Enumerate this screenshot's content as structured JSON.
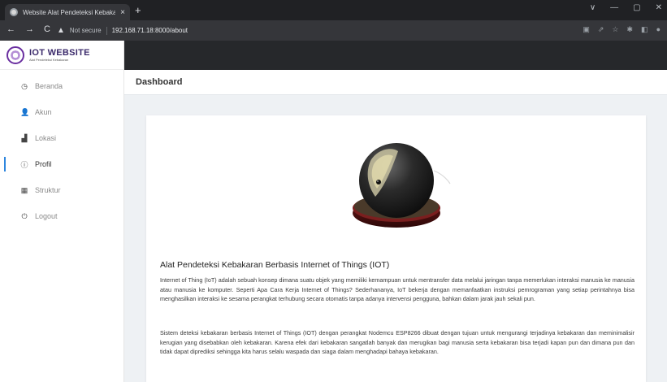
{
  "browser": {
    "tab_title": "Website Alat Pendeteksi Kebaka",
    "tab_close": "×",
    "new_tab": "+",
    "security_label": "Not secure",
    "url": "192.168.71.18:8000/about",
    "window_controls": [
      "∨",
      "—",
      "▢",
      "✕"
    ],
    "nav": [
      "←",
      "→",
      "C"
    ]
  },
  "brand": {
    "title": "IOT WEBSITE",
    "subtitle": "Alat Pendeteksi Kebakaran"
  },
  "sidebar": {
    "items": [
      {
        "label": "Beranda",
        "icon": "clock-icon",
        "glyph": "◷",
        "active": false
      },
      {
        "label": "Akun",
        "icon": "user-icon",
        "glyph": "👤",
        "active": false
      },
      {
        "label": "Lokasi",
        "icon": "map-icon",
        "glyph": "▟",
        "active": false
      },
      {
        "label": "Profil",
        "icon": "info-icon",
        "glyph": "ⓘ",
        "active": true
      },
      {
        "label": "Struktur",
        "icon": "table-icon",
        "glyph": "▦",
        "active": false
      },
      {
        "label": "Logout",
        "icon": "power-icon",
        "glyph": "⏻",
        "active": false
      }
    ]
  },
  "header": {
    "title": "Dashboard"
  },
  "article": {
    "title": "Alat Pendeteksi Kebakaran Berbasis Internet of Things (IOT)",
    "paragraph1": "Internet of Thing (IoT) adalah sebuah konsep dimana suatu objek yang memiliki kemampuan untuk mentransfer data melalui jaringan tanpa memerlukan interaksi manusia ke manusia atau manusia ke komputer. Seperti Apa Cara Kerja Internet of Things? Sederhananya, IoT bekerja dengan memanfaatkan instruksi pemrograman yang setiap perintahnya bisa menghasilkan interaksi ke sesama perangkat terhubung secara otomatis tanpa adanya intervensi pengguna, bahkan dalam jarak jauh sekali pun.",
    "paragraph2": "Sistem deteksi kebakaran berbasis Internet of Things (IOT) dengan perangkat Nodemcu ESP8266 dibuat dengan tujuan untuk mengurangi terjadinya kebakaran dan meminimalisir kerugian yang disebabkan oleh kebakaran. Karena efek dari kebakaran sangatlah banyak dan merugikan bagi manusia serta kebakaran bisa terjadi kapan pun dan dimana pun dan tidak dapat diprediksi sehingga kita harus selalu waspada dan siaga dalam menghadapi bahaya kebakaran."
  }
}
